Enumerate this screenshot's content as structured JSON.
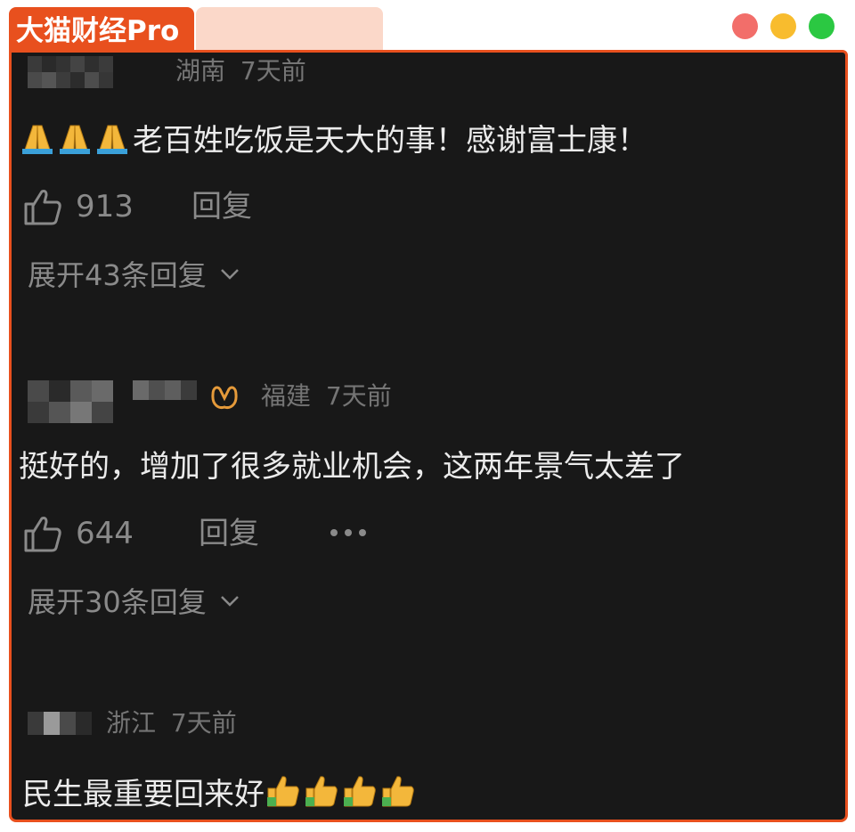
{
  "brand": {
    "title": "大猫财经Pro"
  },
  "window_controls": [
    "close",
    "minimize",
    "maximize"
  ],
  "comments": [
    {
      "location": "湖南",
      "time": "7天前",
      "emoji_prefix": [
        "folded-hands",
        "folded-hands",
        "folded-hands"
      ],
      "text": "老百姓吃饭是天大的事！感谢富士康！",
      "likes": "913",
      "reply_label": "回复",
      "expand_label": "展开43条回复"
    },
    {
      "location": "福建",
      "time": "7天前",
      "badge_icon": "butterfly-icon",
      "text": "挺好的，增加了很多就业机会，这两年景气太差了",
      "likes": "644",
      "reply_label": "回复",
      "more_icon": "more-dots-icon",
      "expand_label": "展开30条回复"
    },
    {
      "location": "浙江",
      "time": "7天前",
      "text": "民生最重要回来好",
      "emoji_suffix": [
        "thumbs-up",
        "thumbs-up",
        "thumbs-up",
        "thumbs-up"
      ]
    }
  ],
  "colors": {
    "brand_orange": "#e8501e",
    "panel_bg": "#181818",
    "text_primary": "#ebebeb",
    "text_secondary": "#8a8a8a",
    "badge_orange": "#e59a3a"
  }
}
